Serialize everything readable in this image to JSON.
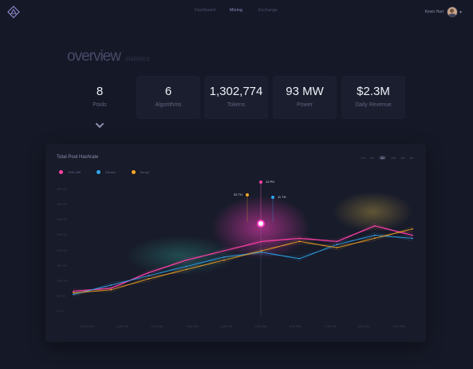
{
  "nav": {
    "items": [
      "Dashboard",
      "Mining",
      "Exchange"
    ],
    "active_index": 1
  },
  "user": {
    "name": "Kevin Hart"
  },
  "heading": {
    "title": "overview",
    "subtitle": "statistics"
  },
  "stats": [
    {
      "value": "8",
      "label": "Pools"
    },
    {
      "value": "6",
      "label": "Algorithms"
    },
    {
      "value": "1,302,774",
      "label": "Tokens"
    },
    {
      "value": "93 MW",
      "label": "Power"
    },
    {
      "value": "$2.3M",
      "label": "Daily Revenue"
    }
  ],
  "panel": {
    "title": "Total Pool Hashrate",
    "ranges": [
      "1H",
      "6H",
      "1D",
      "1W",
      "1M",
      "All"
    ],
    "selected_range": "1D",
    "legend": [
      {
        "name": "SHA-256",
        "color": "#ff3fa6"
      },
      {
        "name": "Ethash",
        "color": "#2fa6f0"
      },
      {
        "name": "Scrypt",
        "color": "#f6a623"
      }
    ],
    "y_ticks": [
      "400 TH",
      "350 TH",
      "300 TH",
      "250 TH",
      "200 TH",
      "150 TH",
      "100 TH",
      "50 TH",
      "0 TH"
    ],
    "x_ticks": [
      "12:00 PM",
      "1:00 PM",
      "2:00 PM",
      "3:00 PM",
      "4:00 PM",
      "5:00 PM",
      "6:00 PM",
      "7:00 PM",
      "8:00 PM",
      "9:00 PM"
    ],
    "callouts": [
      {
        "label": "12 PH",
        "color": "#ff3fa6"
      },
      {
        "label": "32 TH",
        "color": "#f6a623"
      },
      {
        "label": "11 TH",
        "color": "#2fa6f0"
      }
    ]
  },
  "chart_data": {
    "type": "line",
    "title": "Total Pool Hashrate",
    "xlabel": "",
    "ylabel": "",
    "ylim": [
      0,
      400
    ],
    "grid": false,
    "legend": "top-left",
    "x": [
      "12:00 PM",
      "1:00 PM",
      "2:00 PM",
      "3:00 PM",
      "4:00 PM",
      "5:00 PM",
      "6:00 PM",
      "7:00 PM",
      "8:00 PM",
      "9:00 PM"
    ],
    "series": [
      {
        "name": "SHA-256",
        "color": "#ff3fa6",
        "values": [
          70,
          80,
          130,
          170,
          200,
          230,
          240,
          230,
          280,
          250
        ]
      },
      {
        "name": "Ethash",
        "color": "#2fa6f0",
        "values": [
          60,
          90,
          120,
          150,
          180,
          195,
          175,
          220,
          250,
          240
        ]
      },
      {
        "name": "Scrypt",
        "color": "#f6a623",
        "values": [
          65,
          75,
          110,
          140,
          170,
          200,
          230,
          210,
          240,
          270
        ]
      }
    ]
  }
}
